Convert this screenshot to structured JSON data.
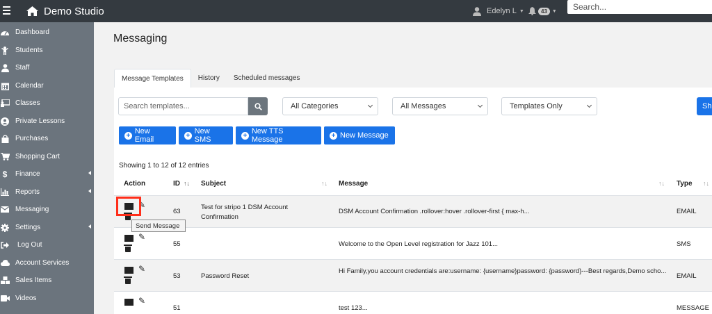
{
  "header": {
    "brand": "Demo Studio",
    "user_name": "Edelyn L",
    "notification_count": "43",
    "search_placeholder": "Search..."
  },
  "sidebar": {
    "items": [
      {
        "label": "Dashboard",
        "icon": "tachometer-icon"
      },
      {
        "label": "Students",
        "icon": "child-icon"
      },
      {
        "label": "Staff",
        "icon": "staff-icon"
      },
      {
        "label": "Calendar",
        "icon": "calendar-icon"
      },
      {
        "label": "Classes",
        "icon": "chalkboard-icon"
      },
      {
        "label": "Private Lessons",
        "icon": "user-circle-icon"
      },
      {
        "label": "Purchases",
        "icon": "shopping-bag-icon"
      },
      {
        "label": "Shopping Cart",
        "icon": "shopping-cart-icon"
      },
      {
        "label": "Finance",
        "icon": "dollar-icon"
      },
      {
        "label": "Reports",
        "icon": "bar-chart-icon"
      },
      {
        "label": "Messaging",
        "icon": "envelope-icon"
      },
      {
        "label": "Settings",
        "icon": "gear-icon"
      },
      {
        "label": "Log Out",
        "icon": "sign-out-icon"
      },
      {
        "label": "Account Services",
        "icon": "cloud-icon"
      },
      {
        "label": "Sales Items",
        "icon": "cubes-icon"
      },
      {
        "label": "Videos",
        "icon": "video-icon"
      }
    ]
  },
  "main": {
    "title": "Messaging",
    "tabs": [
      "Message Templates",
      "History",
      "Scheduled messages"
    ],
    "search_placeholder": "Search templates...",
    "filters": {
      "category": "All Categories",
      "messages": "All Messages",
      "templates": "Templates Only",
      "show_button": "Sh"
    },
    "buttons": {
      "new_email": "New Email",
      "new_sms": "New SMS",
      "new_tts": "New TTS Message",
      "new_message": "New Message"
    },
    "showing": "Showing 1 to 12 of 12 entries",
    "columns": {
      "action": "Action",
      "id": "ID",
      "subject": "Subject",
      "message": "Message",
      "type": "Type"
    },
    "rows": [
      {
        "id": "63",
        "subject": "Test for stripo 1 DSM Account Confirmation",
        "message": "DSM Account Confirmation .rollover:hover .rollover-first { max-h...",
        "type": "EMAIL"
      },
      {
        "id": "55",
        "subject": "",
        "message": "Welcome to the Open Level registration for Jazz 101...",
        "type": "SMS"
      },
      {
        "id": "53",
        "subject": "Password Reset",
        "message": "Hi Family,you account credentials are:username: {username}password: {password}---Best regards,Demo scho...",
        "type": "EMAIL"
      },
      {
        "id": "51",
        "subject": "",
        "message": "test 123...",
        "type": "MESSAGE"
      }
    ],
    "tooltip": "Send Message"
  },
  "colors": {
    "topbar": "#343a40",
    "sidebar": "#6b747d",
    "primary": "#1a73e8",
    "highlight": "#ff2e1a"
  }
}
